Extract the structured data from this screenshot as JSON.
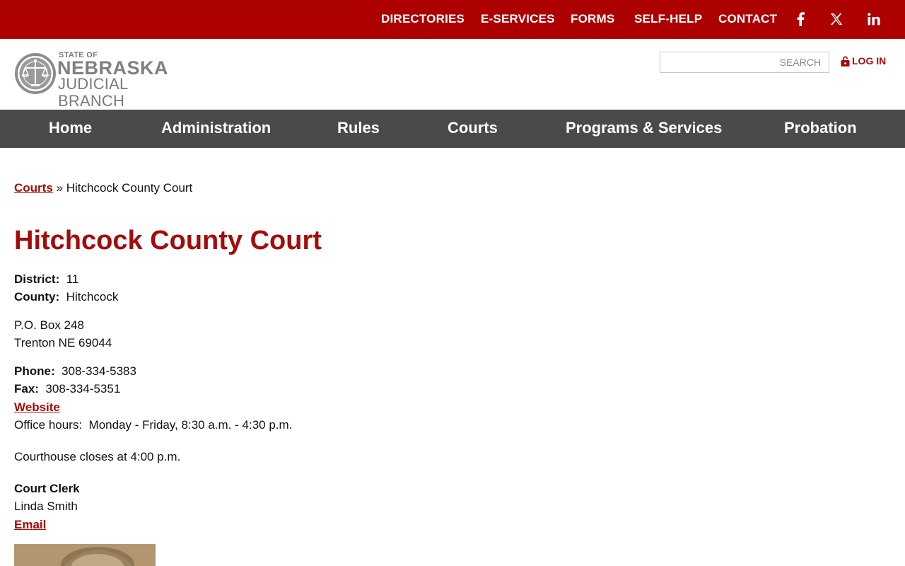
{
  "utility_nav": [
    "DIRECTORIES",
    "E-SERVICES",
    "FORMS",
    "SELF-HELP",
    "CONTACT"
  ],
  "social": {
    "facebook": "facebook-icon",
    "x": "x-icon",
    "linkedin": "linkedin-icon"
  },
  "logo": {
    "state": "STATE OF",
    "name": "NEBRASKA",
    "branch": "JUDICIAL BRANCH"
  },
  "search": {
    "placeholder": "SEARCH"
  },
  "login": {
    "label": "LOG IN"
  },
  "main_nav": [
    "Home",
    "Administration",
    "Rules",
    "Courts",
    "Programs & Services",
    "Probation"
  ],
  "breadcrumb": {
    "link": "Courts",
    "separator": "»",
    "current": "Hitchcock County Court"
  },
  "page": {
    "title": "Hitchcock County Court",
    "district_label": "District:",
    "district": "11",
    "county_label": "County:",
    "county": "Hitchcock",
    "address_line1": "P.O. Box 248",
    "address_line2": "Trenton NE 69044",
    "phone_label": "Phone:",
    "phone": "308-334-5383",
    "fax_label": "Fax:",
    "fax": "308-334-5351",
    "website_link": "Website",
    "office_hours_label": "Office hours:",
    "office_hours": "Monday - Friday, 8:30 a.m. - 4:30 p.m.",
    "note": "Courthouse closes at 4:00 p.m.",
    "clerk_title": "Court Clerk",
    "clerk_name": "Linda Smith",
    "email_link": "Email"
  },
  "colors": {
    "topbar": "#ad0000",
    "nav": "#4a4a4a",
    "accent": "#a50b0b"
  }
}
